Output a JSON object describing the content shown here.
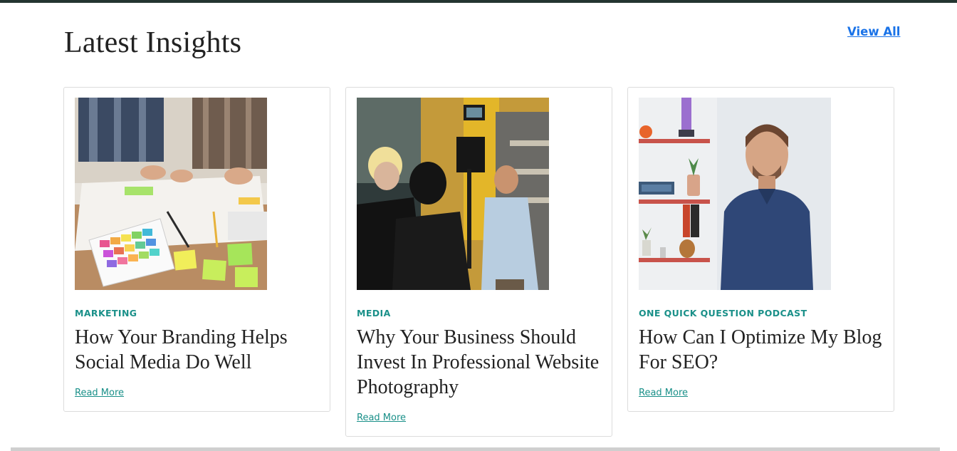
{
  "section": {
    "title": "Latest Insights",
    "view_all_label": "View All"
  },
  "posts": [
    {
      "category": "MARKETING",
      "title": "How Your Branding Helps Social Media Do Well",
      "read_more": "Read More",
      "image": "team-planning-with-color-swatches-photo"
    },
    {
      "category": "MEDIA",
      "title": "Why Your Business Should Invest In Professional Website Photography",
      "read_more": "Read More",
      "image": "video-crew-filming-interview-photo"
    },
    {
      "category": "ONE QUICK QUESTION PODCAST",
      "title": "How Can I Optimize My Blog For SEO?",
      "read_more": "Read More",
      "image": "smiling-man-portrait-photo"
    }
  ],
  "colors": {
    "accent_teal": "#1a9089",
    "link_blue": "#1a73e8",
    "top_bar": "#243530",
    "heading_text": "#222222"
  }
}
